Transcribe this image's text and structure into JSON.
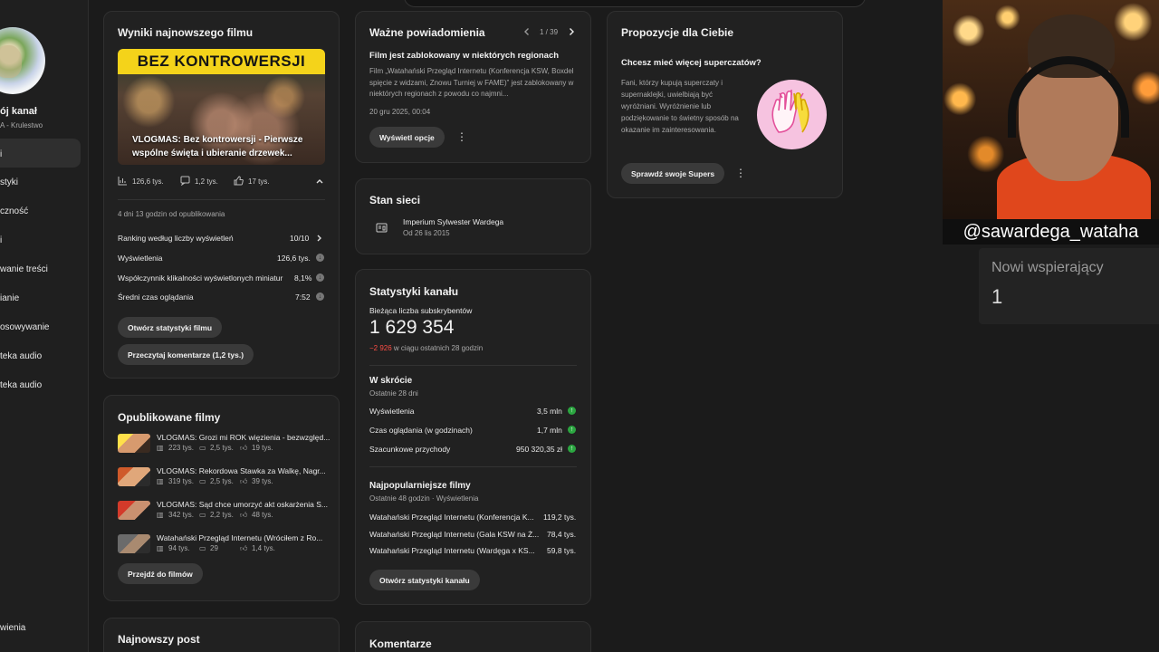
{
  "sidebar": {
    "channel_name": "ój kanał",
    "channel_sub": "A - Krulestwo",
    "items": [
      {
        "label": "i"
      },
      {
        "label": "styki"
      },
      {
        "label": "czność"
      },
      {
        "label": "i"
      },
      {
        "label": "wanie treści"
      },
      {
        "label": "ianie"
      },
      {
        "label": "osowywanie"
      },
      {
        "label": "teka audio"
      }
    ],
    "bottom_item": "wienia"
  },
  "latest_video": {
    "title": "Wyniki najnowszego filmu",
    "thumb_band": "BEZ KONTROWERSJI",
    "thumb_caption": "VLOGMAS: Bez kontrowersji - Pierwsze wspólne święta i ubieranie drzewek...",
    "views": "126,6 tys.",
    "comments": "1,2 tys.",
    "likes": "17 tys.",
    "since": "4 dni 13 godzin od opublikowania",
    "metrics": [
      {
        "label": "Ranking według liczby wyświetleń",
        "value": "10/10"
      },
      {
        "label": "Wyświetlenia",
        "value": "126,6 tys."
      },
      {
        "label": "Współczynnik klikalności wyświetlonych miniatur",
        "value": "8,1%"
      },
      {
        "label": "Średni czas oglądania",
        "value": "7:52"
      }
    ],
    "btn_stats": "Otwórz statystyki filmu",
    "btn_comments": "Przeczytaj komentarze (1,2 tys.)"
  },
  "published": {
    "title": "Opublikowane filmy",
    "videos": [
      {
        "title": "VLOGMAS: Grozi mi ROK więzienia - bezwzględ...",
        "views": "223 tys.",
        "comments": "2,5 tys.",
        "likes": "19 tys."
      },
      {
        "title": "VLOGMAS: Rekordowa Stawka za Walkę, Nagr...",
        "views": "319 tys.",
        "comments": "2,5 tys.",
        "likes": "39 tys."
      },
      {
        "title": "VLOGMAS: Sąd chce umorzyć akt oskarżenia S...",
        "views": "342 tys.",
        "comments": "2,2 tys.",
        "likes": "48 tys."
      },
      {
        "title": "Watahański Przegląd Internetu (Wróciłem z Ro...",
        "views": "94 tys.",
        "comments": "29",
        "likes": "1,4 tys."
      }
    ],
    "btn": "Przejdź do filmów"
  },
  "latest_post": {
    "title": "Najnowszy post"
  },
  "notifications": {
    "title": "Ważne powiadomienia",
    "pager": "1 / 39",
    "heading": "Film jest zablokowany w niektórych regionach",
    "body": "Film „Watahański Przegląd Internetu (Konferencja KSW, Boxdel spięcie z widzami, Znowu Turniej w FAME)” jest zablokowany w niektórych regionach z powodu co najmni...",
    "date": "20 gru 2025, 00:04",
    "btn": "Wyświetl opcje"
  },
  "network": {
    "title": "Stan sieci",
    "name": "Imperium Sylwester Wardega",
    "since": "Od 26 lis 2015"
  },
  "channel_stats": {
    "title": "Statystyki kanału",
    "subs_label": "Bieżąca liczba subskrybentów",
    "subs_value": "1 629 354",
    "subs_change": "−2 926",
    "subs_change_suffix": " w ciągu ostatnich 28 godzin",
    "summary_title": "W skrócie",
    "summary_sub": "Ostatnie 28 dni",
    "summary": [
      {
        "label": "Wyświetlenia",
        "value": "3,5 mln"
      },
      {
        "label": "Czas oglądania (w godzinach)",
        "value": "1,7 mln"
      },
      {
        "label": "Szacunkowe przychody",
        "value": "950 320,35 zł"
      }
    ],
    "top_title": "Najpopularniejsze filmy",
    "top_sub": "Ostatnie 48 godzin · Wyświetlenia",
    "top": [
      {
        "label": "Watahański Przegląd Internetu (Konferencja K...",
        "value": "119,2 tys."
      },
      {
        "label": "Watahański Przegląd Internetu (Gala KSW na Ż...",
        "value": "78,4 tys."
      },
      {
        "label": "Watahański Przegląd Internetu (Wardęga x KS...",
        "value": "59,8 tys."
      }
    ],
    "btn": "Otwórz statystyki kanału"
  },
  "comments": {
    "title": "Komentarze"
  },
  "suggestions": {
    "title": "Propozycje dla Ciebie",
    "heading": "Chcesz mieć więcej superczatów?",
    "body": "Fani, którzy kupują superczaty i supernaklejki, uwielbiają być wyróżniani. Wyróżnienie lub podziękowanie to świetny sposób na okazanie im zainteresowania.",
    "btn": "Sprawdź swoje Supers"
  },
  "overlay": {
    "handle": "@sawardega_wataha",
    "new_supporters_label": "Nowi wspierający",
    "new_supporters_value": "1"
  },
  "colors": {
    "accent_red": "#ff4e45",
    "accent_green": "#2ba640",
    "bg": "#1b1b1b",
    "card": "#212121"
  }
}
